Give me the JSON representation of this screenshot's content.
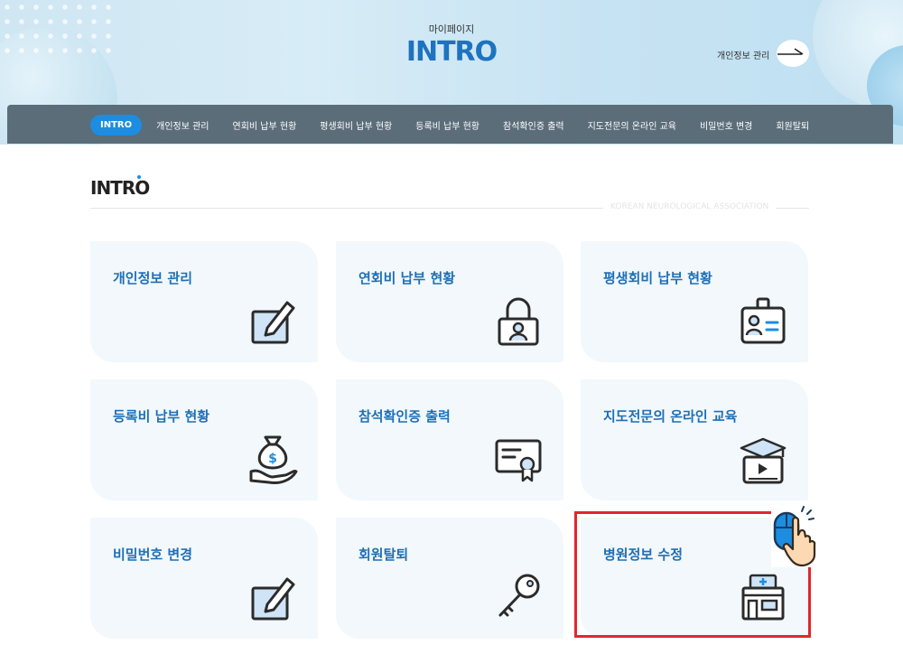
{
  "header": {
    "subtitle": "마이페이지",
    "title": "INTRO",
    "link_label": "개인정보 관리"
  },
  "nav": {
    "items": [
      "INTRO",
      "개인정보 관리",
      "연회비 납부 현황",
      "평생회비 납부 현황",
      "등록비 납부 현황",
      "참석확인증 출력",
      "지도전문의 온라인 교육",
      "비밀번호 변경",
      "회원탈퇴"
    ]
  },
  "section": {
    "title": "INTRO",
    "org": "KOREAN NEUROLOGICAL ASSOCIATION"
  },
  "cards": [
    {
      "label": "개인정보 관리",
      "icon": "edit-icon"
    },
    {
      "label": "연회비 납부 현황",
      "icon": "lock-icon"
    },
    {
      "label": "평생회비 납부 현황",
      "icon": "id-card-icon"
    },
    {
      "label": "등록비 납부 현황",
      "icon": "money-bag-icon"
    },
    {
      "label": "참석확인증 출력",
      "icon": "certificate-icon"
    },
    {
      "label": "지도전문의 온라인 교육",
      "icon": "online-education-icon"
    },
    {
      "label": "비밀번호 변경",
      "icon": "edit-icon"
    },
    {
      "label": "회원탈퇴",
      "icon": "key-icon"
    },
    {
      "label": "병원정보 수정",
      "icon": "hospital-icon"
    }
  ],
  "colors": {
    "accent": "#1c8de0",
    "title": "#1d73bf",
    "navbar": "#5b6d79",
    "card_bg": "#f2f8fc",
    "highlight": "#e3262e"
  }
}
